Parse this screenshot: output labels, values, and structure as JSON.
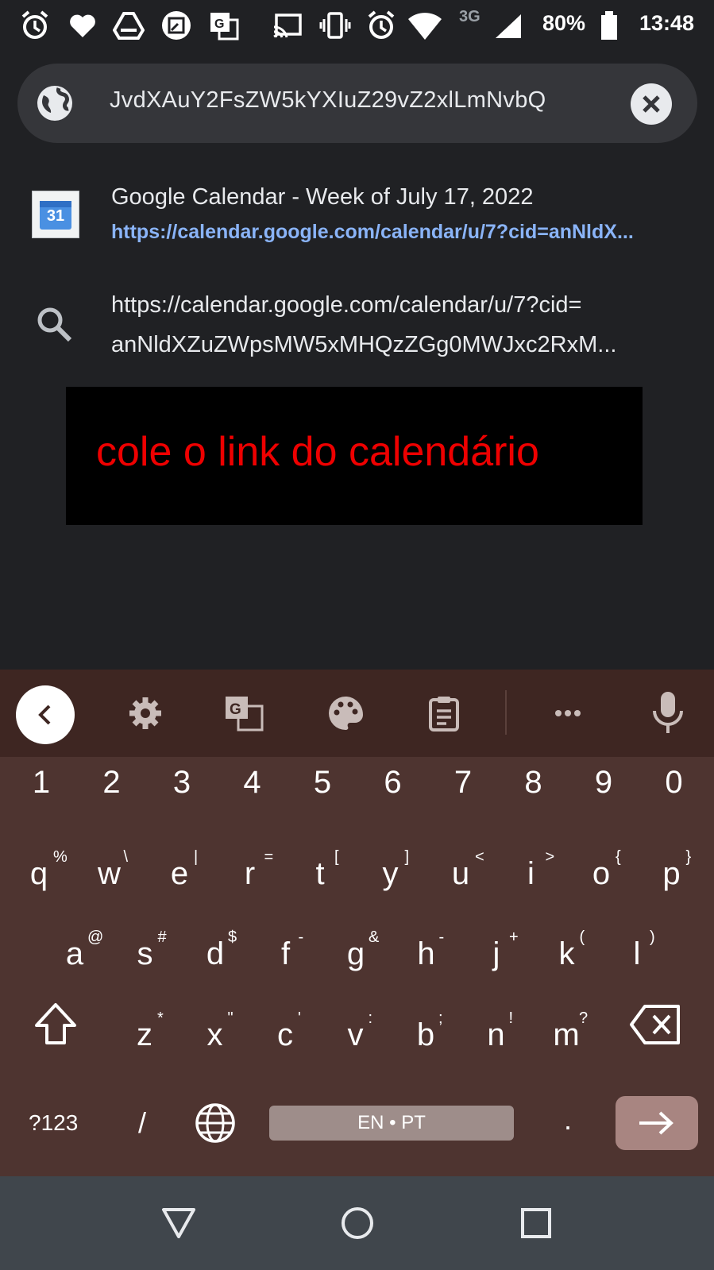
{
  "status_bar": {
    "network": "3G",
    "battery": "80%",
    "time": "13:48",
    "icons": [
      "alarm-icon",
      "heart-icon",
      "drive-icon",
      "screenshot-icon",
      "translate-icon",
      "cast-icon",
      "vibrate-icon",
      "alarm-icon",
      "wifi-icon",
      "signal-icon",
      "battery-icon"
    ]
  },
  "omnibox": {
    "url_text": "JvdXAuY2FsZW5kYXIuZ29vZ2xlLmNvbQ",
    "leading_icon": "globe-icon",
    "clear_icon": "close-icon"
  },
  "suggestions": [
    {
      "favicon_text": "31",
      "title": "Google Calendar - Week of July 17, 2022",
      "url": "https://calendar.google.com/calendar/u/7?cid=anNldX..."
    },
    {
      "icon": "search-icon",
      "line1": "https://calendar.google.com/calendar/u/7?cid=",
      "line2": "anNldXZuZWpsMW5xMHQzZGg0MWJxc2RxM..."
    }
  ],
  "caption": "cole o link do calendário",
  "keyboard_toolbar": {
    "tools": [
      "back-icon",
      "gear-icon",
      "translate-icon",
      "palette-icon",
      "clipboard-icon",
      "more-icon",
      "microphone-icon"
    ]
  },
  "keyboard": {
    "number_row": [
      "1",
      "2",
      "3",
      "4",
      "5",
      "6",
      "7",
      "8",
      "9",
      "0"
    ],
    "row1": [
      {
        "k": "q",
        "h": "%"
      },
      {
        "k": "w",
        "h": "\\"
      },
      {
        "k": "e",
        "h": "|"
      },
      {
        "k": "r",
        "h": "="
      },
      {
        "k": "t",
        "h": "["
      },
      {
        "k": "y",
        "h": "]"
      },
      {
        "k": "u",
        "h": "<"
      },
      {
        "k": "i",
        "h": ">"
      },
      {
        "k": "o",
        "h": "{"
      },
      {
        "k": "p",
        "h": "}"
      }
    ],
    "row2": [
      {
        "k": "a",
        "h": "@"
      },
      {
        "k": "s",
        "h": "#"
      },
      {
        "k": "d",
        "h": "$"
      },
      {
        "k": "f",
        "h": "-"
      },
      {
        "k": "g",
        "h": "&"
      },
      {
        "k": "h",
        "h": "-"
      },
      {
        "k": "j",
        "h": "+"
      },
      {
        "k": "k",
        "h": "("
      },
      {
        "k": "l",
        "h": ")"
      }
    ],
    "row3": [
      {
        "k": "z",
        "h": "*"
      },
      {
        "k": "x",
        "h": "\""
      },
      {
        "k": "c",
        "h": "'"
      },
      {
        "k": "v",
        "h": ":"
      },
      {
        "k": "b",
        "h": ";"
      },
      {
        "k": "n",
        "h": "!"
      },
      {
        "k": "m",
        "h": "?"
      }
    ],
    "symbols_label": "?123",
    "slash_label": "/",
    "space_label": "EN • PT",
    "period_label": "."
  },
  "colors": {
    "caption_text": "#ee0000",
    "url_link": "#8ab4f8",
    "keyboard_bg": "#4e3430",
    "toolbar_bg": "#3e2622"
  }
}
